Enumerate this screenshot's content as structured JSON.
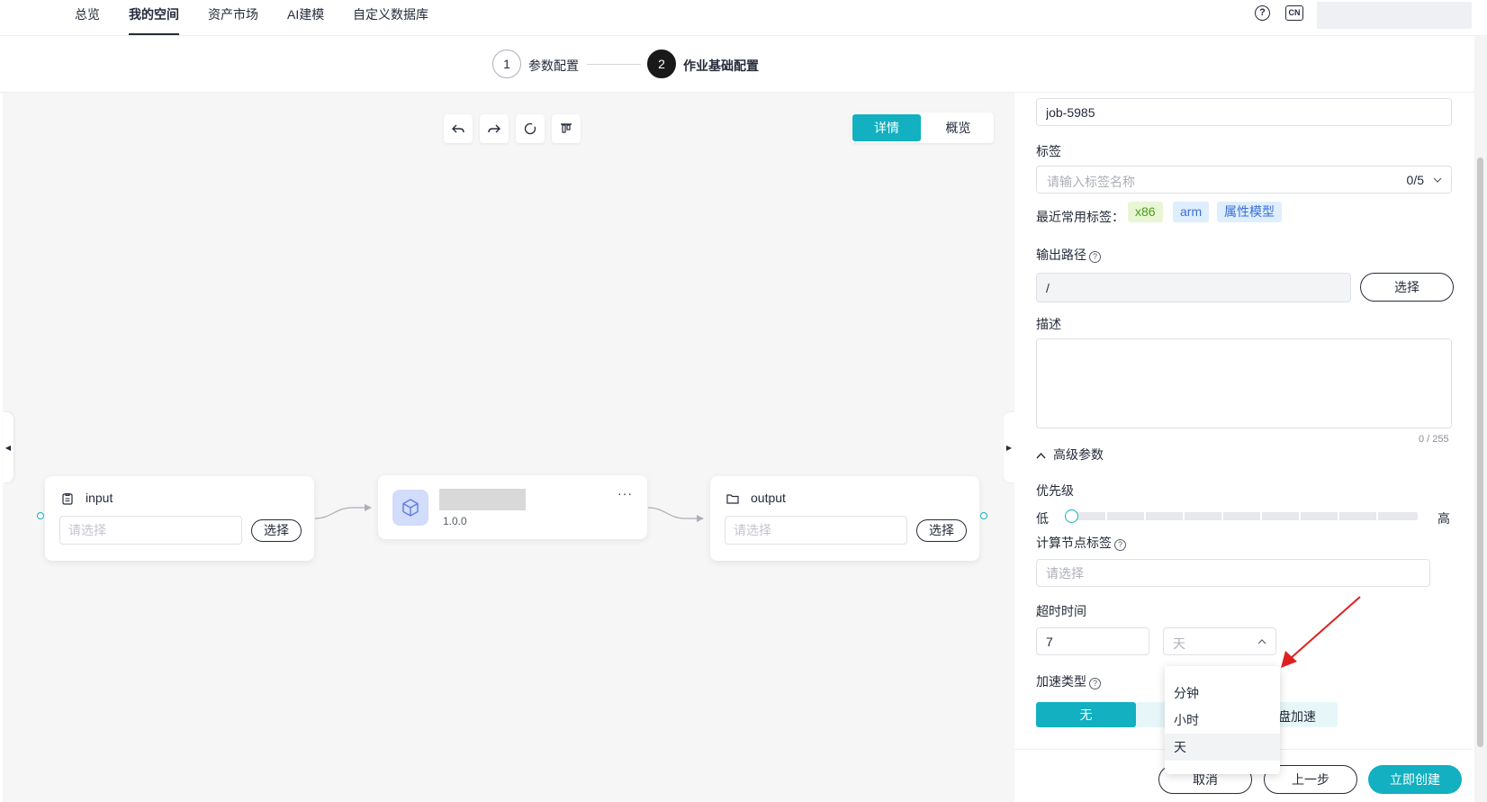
{
  "nav": {
    "items": [
      "总览",
      "我的空间",
      "资产市场",
      "AI建模",
      "自定义数据库"
    ],
    "active": "我的空间",
    "help_icon": "question-circle-icon",
    "lang_label": "CN"
  },
  "steps": [
    {
      "number": "1",
      "label": "参数配置"
    },
    {
      "number": "2",
      "label": "作业基础配置"
    }
  ],
  "canvas": {
    "toolbar_icons": [
      "undo-icon",
      "redo-icon",
      "refresh-icon",
      "align-top-icon"
    ],
    "view_toggle": {
      "detail": "详情",
      "overview": "概览",
      "active": "详情"
    },
    "nodes": {
      "input": {
        "title": "input",
        "placeholder": "请选择",
        "button": "选择"
      },
      "algorithm": {
        "version": "1.0.0",
        "more": "···"
      },
      "output": {
        "title": "output",
        "placeholder": "请选择",
        "button": "选择"
      }
    }
  },
  "form": {
    "job_name_value": "job-5985",
    "tags": {
      "label": "标签",
      "placeholder": "请输入标签名称",
      "count": "0/5"
    },
    "recent_tags": {
      "label": "最近常用标签：",
      "items": [
        "x86",
        "arm",
        "属性模型"
      ]
    },
    "output_path": {
      "label": "输出路径",
      "prefix": "/",
      "button": "选择"
    },
    "description": {
      "label": "描述",
      "count": "0 / 255"
    },
    "advanced": {
      "label": "高级参数"
    },
    "priority": {
      "label": "优先级",
      "low": "低",
      "high": "高",
      "level": 0
    },
    "compute_node_tag": {
      "label": "计算节点标签",
      "placeholder": "请选择"
    },
    "timeout": {
      "label": "超时时间",
      "value": "7",
      "unit_placeholder": "天"
    },
    "acceleration": {
      "label": "加速类型",
      "options": [
        "无",
        "盘加速"
      ],
      "selected": "无"
    },
    "timeout_unit_options": [
      "分钟",
      "小时",
      "天"
    ],
    "timeout_unit_selected": "天"
  },
  "footer": {
    "cancel": "取消",
    "prev": "上一步",
    "create": "立即创建"
  },
  "colors": {
    "accent": "#12b0c0",
    "annotation_arrow": "#e02020"
  }
}
